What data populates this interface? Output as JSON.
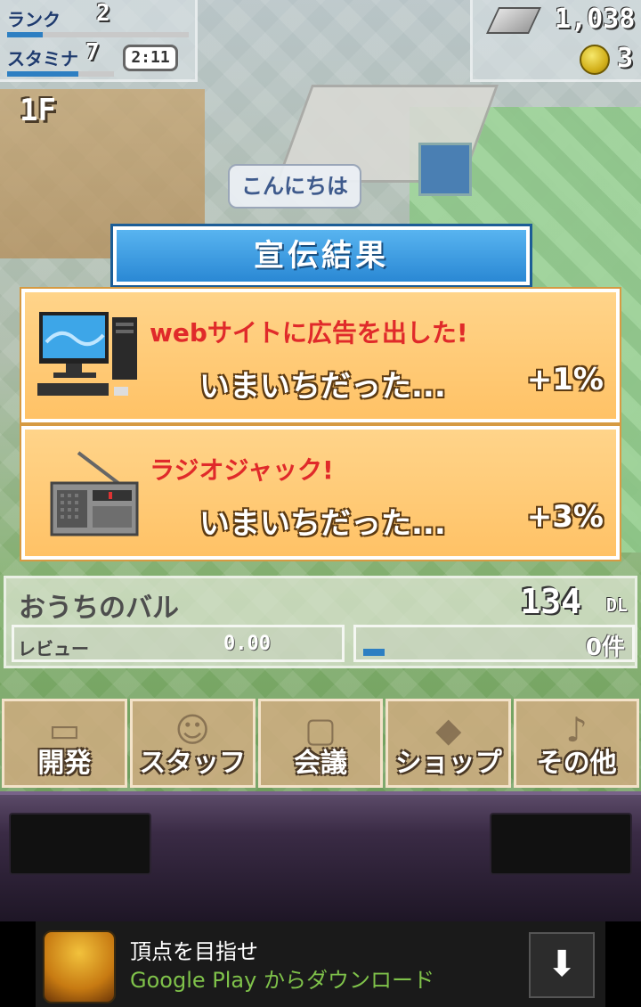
{
  "hud": {
    "rank_label": "ランク",
    "rank_value": "2",
    "stamina_label": "スタミナ",
    "stamina_value": "7",
    "timer": "2:11",
    "floor": "1F",
    "money": "1,038",
    "coins": "3"
  },
  "speech_bubble": "こんにちは",
  "dialog": {
    "title": "宣伝結果",
    "results": [
      {
        "icon": "computer-icon",
        "headline": "webサイトに広告を出した!",
        "result": "いまいちだった...",
        "change": "+1%"
      },
      {
        "icon": "radio-icon",
        "headline": "ラジオジャック!",
        "result": "いまいちだった...",
        "change": "+3%"
      }
    ]
  },
  "game_info": {
    "name": "おうちのバル",
    "downloads": "134",
    "downloads_unit": "DL",
    "review_label": "レビュー",
    "review_value": "0.00",
    "count": "0件"
  },
  "menu": [
    {
      "label": "開発",
      "icon": "monitor-icon"
    },
    {
      "label": "スタッフ",
      "icon": "staff-icon"
    },
    {
      "label": "会議",
      "icon": "meeting-icon"
    },
    {
      "label": "ショップ",
      "icon": "shop-icon"
    },
    {
      "label": "その他",
      "icon": "music-icon"
    }
  ],
  "ad": {
    "title": "頂点を目指せ",
    "subtitle": "Google Play からダウンロード",
    "download_icon": "download-arrow-icon"
  }
}
